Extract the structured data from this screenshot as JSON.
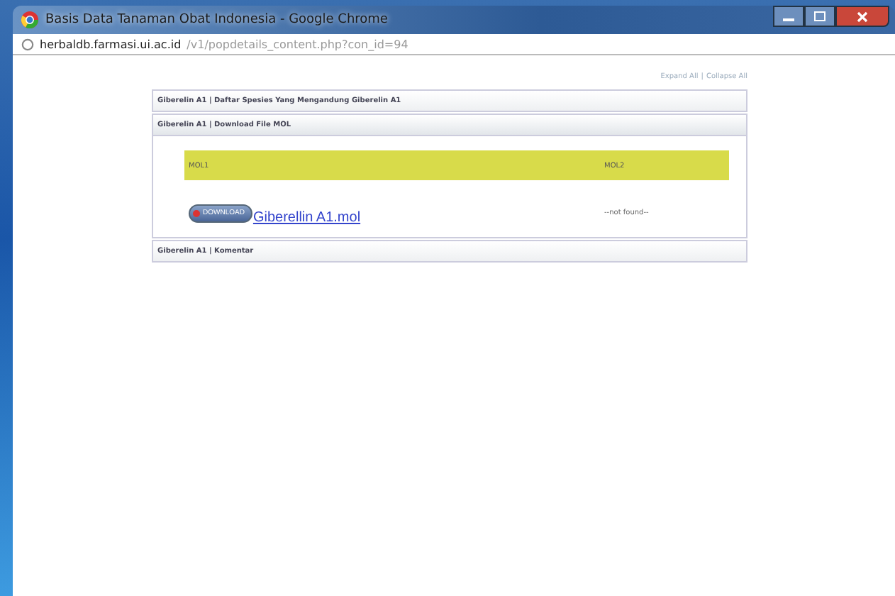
{
  "window": {
    "title": "Basis Data Tanaman Obat Indonesia - Google Chrome"
  },
  "address_bar": {
    "host": "herbaldb.farmasi.ui.ac.id",
    "path": "/v1/popdetails_content.php?con_id=94"
  },
  "toggle_links": [
    "Expand All",
    "|",
    "Collapse All"
  ],
  "sections": [
    {
      "title": "Giberelin A1 | Daftar Spesies Yang Mengandung Giberelin A1",
      "expanded": false
    },
    {
      "title": "Giberelin A1 | Download File MOL",
      "expanded": true,
      "table": {
        "columns": [
          "MOL1",
          "MOL2"
        ],
        "download_button": "DOWNLOAD",
        "file_link": "Giberellin A1.mol",
        "column_2_value": "--not found--"
      }
    },
    {
      "title": "Giberelin A1 | Komentar",
      "expanded": false
    }
  ]
}
